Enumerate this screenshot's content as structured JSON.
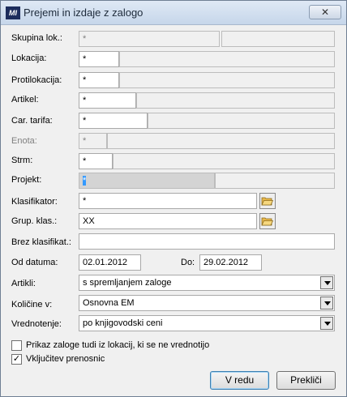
{
  "window": {
    "title": "Prejemi in izdaje z zalogo",
    "app_icon_text": "MI",
    "close_glyph": "✕"
  },
  "fields": {
    "skupina_lok": {
      "label": "Skupina lok.:",
      "value": "*"
    },
    "lokacija": {
      "label": "Lokacija:",
      "value": "*"
    },
    "protilokacija": {
      "label": "Protilokacija:",
      "value": "*"
    },
    "artikel": {
      "label": "Artikel:",
      "value": "*"
    },
    "car_tarifa": {
      "label": "Car. tarifa:",
      "value": "*"
    },
    "enota": {
      "label": "Enota:",
      "value": "*"
    },
    "strm": {
      "label": "Strm:",
      "value": "*"
    },
    "projekt": {
      "label": "Projekt:",
      "value": "*"
    },
    "klasifikator": {
      "label": "Klasifikator:",
      "value": "*"
    },
    "grup_klas": {
      "label": "Grup. klas.:",
      "value": "XX"
    },
    "brez_klasifikat": {
      "label": "Brez klasifikat.:",
      "value": ""
    },
    "od_datuma": {
      "label": "Od datuma:",
      "value": "02.01.2012"
    },
    "do": {
      "label": "Do:",
      "value": "29.02.2012"
    },
    "artikli": {
      "label": "Artikli:",
      "value": "s spremljanjem zaloge"
    },
    "kolicine": {
      "label": "Količine v:",
      "value": "Osnovna EM"
    },
    "vrednotenje": {
      "label": "Vrednotenje:",
      "value": "po knjigovodski ceni"
    }
  },
  "checkboxes": {
    "prikaz_zaloge": {
      "label": "Prikaz zaloge tudi iz lokacij, ki se ne vrednotijo",
      "checked": false,
      "mark": ""
    },
    "vkljucitev": {
      "label": "Vključitev prenosnic",
      "checked": true,
      "mark": "✓"
    }
  },
  "buttons": {
    "ok": "V redu",
    "cancel": "Prekliči"
  },
  "colors": {
    "title_bar": "#c6d6ea",
    "selection": "#3399ff",
    "folder_icon": "#e8b84a"
  }
}
